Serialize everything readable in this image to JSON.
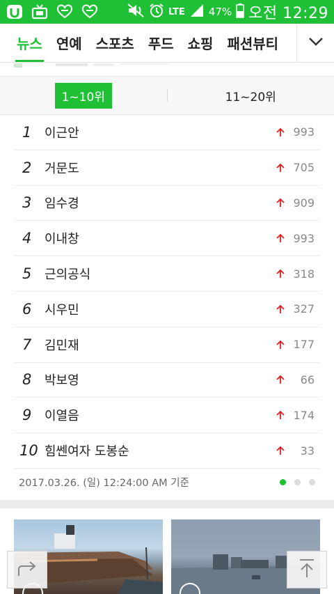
{
  "status_bar": {
    "network": "LTE",
    "battery_pct": "47%",
    "time": "오전 12:29",
    "colors": {
      "bg": "#20c036"
    }
  },
  "tabs": [
    {
      "label": "뉴스",
      "active": true
    },
    {
      "label": "연예",
      "active": false
    },
    {
      "label": "스포츠",
      "active": false
    },
    {
      "label": "푸드",
      "active": false
    },
    {
      "label": "쇼핑",
      "active": false
    },
    {
      "label": "패션뷰티",
      "active": false
    }
  ],
  "tab_more_icon": "chevron-down-icon",
  "range_tabs": [
    {
      "label": "1~10위",
      "active": true
    },
    {
      "label": "11~20위",
      "active": false
    }
  ],
  "ranking": [
    {
      "rank": "1",
      "keyword": "이근안",
      "change": "993"
    },
    {
      "rank": "2",
      "keyword": "거문도",
      "change": "705"
    },
    {
      "rank": "3",
      "keyword": "임수경",
      "change": "909"
    },
    {
      "rank": "4",
      "keyword": "이내창",
      "change": "993"
    },
    {
      "rank": "5",
      "keyword": "근의공식",
      "change": "318"
    },
    {
      "rank": "6",
      "keyword": "시우민",
      "change": "327"
    },
    {
      "rank": "7",
      "keyword": "김민재",
      "change": "177"
    },
    {
      "rank": "8",
      "keyword": "박보영",
      "change": "66"
    },
    {
      "rank": "9",
      "keyword": "이열음",
      "change": "174"
    },
    {
      "rank": "10",
      "keyword": "힘쎈여자 도봉순",
      "change": "33"
    }
  ],
  "timestamp": "2017.03.26. (일) 12:24:00 AM 기준",
  "page_dots": {
    "count": 3,
    "active": 0
  },
  "colors": {
    "accent": "#20c036",
    "up_arrow": "#e02020"
  }
}
